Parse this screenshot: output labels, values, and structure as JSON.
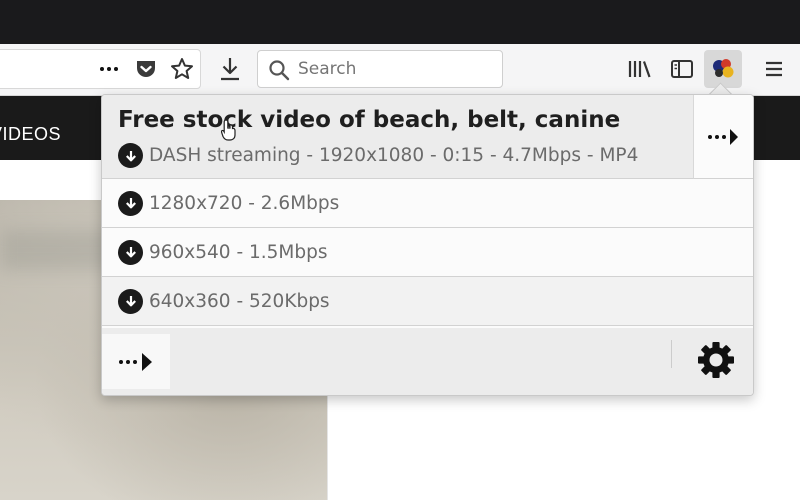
{
  "browser": {
    "search": {
      "placeholder": "Search"
    },
    "icons": [
      "page-actions-icon",
      "pocket-icon",
      "bookmark-star-icon",
      "downloads-icon",
      "library-icon",
      "sidebar-icon",
      "video-downloadhelper-icon",
      "hamburger-menu-icon"
    ]
  },
  "site": {
    "nav_label": "VIDEOS"
  },
  "popup": {
    "title": "Free stock video of beach, belt, canine",
    "main_variant": "DASH streaming - 1920x1080 - 0:15 - 4.7Mbps - MP4",
    "variants": [
      "1280x720 - 2.6Mbps",
      "960x540 - 1.5Mbps",
      "640x360 - 520Kbps"
    ]
  },
  "colors": {
    "topbar": "#1a1a1c",
    "popup_bg": "#fbfbfb",
    "popup_highlight": "#ececec",
    "icon_dark": "#1b1b1b"
  }
}
